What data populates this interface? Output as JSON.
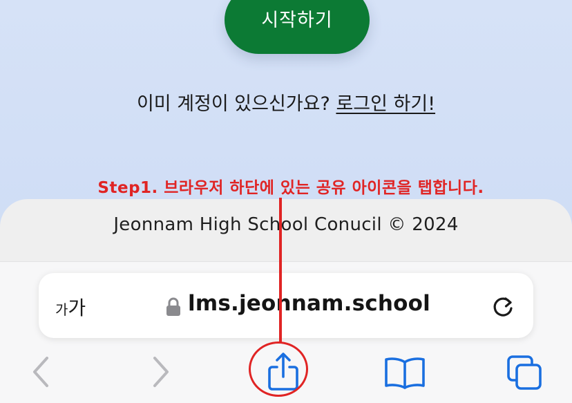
{
  "page": {
    "start_button_label": "시작하기",
    "login_prompt_text": "이미 계정이 있으신가요?",
    "login_link_label": "로그인 하기!",
    "footer_text": "Jeonnam High School Conucil © 2024"
  },
  "annotation": {
    "instruction_text": "Step1. 브라우저 하단에 있는 공유 아이콘을 탭합니다.",
    "color": "#e02424"
  },
  "browser": {
    "text_size_small": "가",
    "text_size_large": "가",
    "url": "lms.jeonnam.school",
    "icons": {
      "lock": "lock-icon",
      "reload": "reload-icon",
      "back": "back-icon",
      "forward": "forward-icon",
      "share": "share-icon",
      "bookmarks": "bookmarks-icon",
      "tabs": "tabs-icon"
    },
    "accent_color": "#1a6fe0"
  },
  "colors": {
    "brand_green": "#0c7a34",
    "page_background": "#d6e2f7"
  }
}
